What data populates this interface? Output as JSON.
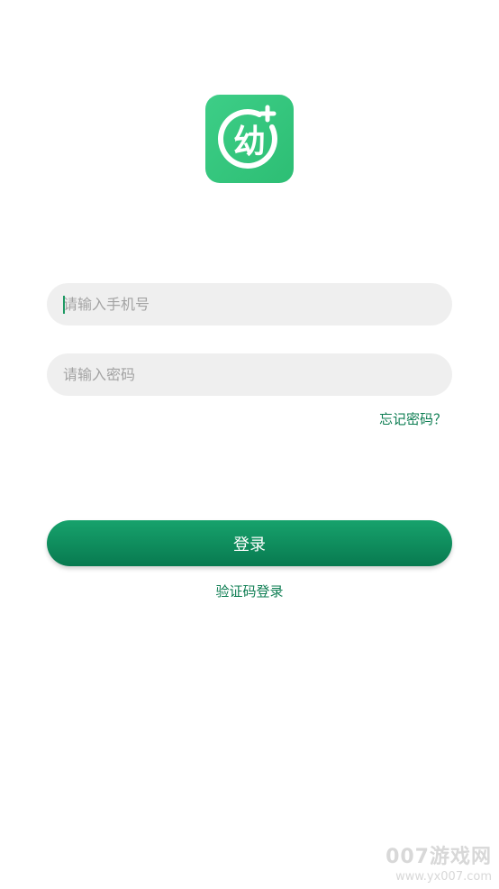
{
  "app": {
    "logo_glyph": "幼",
    "logo_colors": [
      "#3dce87",
      "#2dbe74"
    ]
  },
  "login": {
    "phone_placeholder": "请输入手机号",
    "password_placeholder": "请输入密码",
    "forgot_password": "忘记密码？",
    "login_button": "登录",
    "code_login": "验证码登录"
  },
  "watermark": {
    "title": "007游戏网",
    "url": "www.yx007.com"
  },
  "colors": {
    "accent": "#0d7d52",
    "button_top": "#17a26c",
    "button_bottom": "#087a50",
    "input_bg": "#efefef"
  }
}
